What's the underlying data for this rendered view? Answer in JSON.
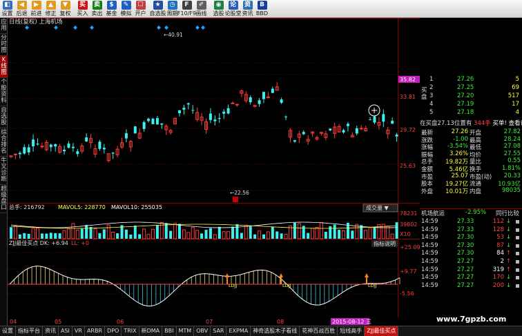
{
  "toolbar": [
    {
      "name": "sell-back-button",
      "label": "设置",
      "color": "#3a6ab8",
      "glyph": "◧"
    },
    {
      "name": "back-button",
      "label": "后退",
      "color": "#e09a20",
      "glyph": "◀"
    },
    {
      "name": "forward-button",
      "label": "前进",
      "color": "#e09a20",
      "glyph": "▶"
    },
    {
      "name": "up-button",
      "label": "修正",
      "color": "#e09a20",
      "glyph": "▲"
    },
    {
      "name": "down-button",
      "label": "复权",
      "color": "#e09a20",
      "glyph": "▼"
    },
    {
      "name": "buy-button",
      "label": "买入",
      "color": "#d01010",
      "glyph": "买"
    },
    {
      "name": "sell-button",
      "label": "卖出",
      "color": "#108010",
      "glyph": "卖"
    },
    {
      "name": "fund-button",
      "label": "基金",
      "color": "#2060c0",
      "glyph": "$"
    },
    {
      "name": "simulate-button",
      "label": "模拟",
      "color": "#2060c0",
      "glyph": "✎"
    },
    {
      "name": "open-account-button",
      "label": "开户",
      "color": "#c04040",
      "glyph": "☐"
    },
    {
      "name": "watchlist-button",
      "label": "自选股",
      "color": "#2050a0",
      "glyph": "★"
    },
    {
      "name": "period-button",
      "label": "周期",
      "color": "#2070c0",
      "glyph": "◷"
    },
    {
      "name": "f10-button",
      "label": "F10/F9",
      "color": "#404040",
      "glyph": "F"
    },
    {
      "name": "draw-line-button",
      "label": "画线",
      "color": "#606060",
      "glyph": "✐"
    },
    {
      "name": "stock-picker-button",
      "label": "选股",
      "color": "#208040",
      "glyph": "◉"
    },
    {
      "name": "forum-button",
      "label": "论股堂",
      "color": "#2060c0",
      "glyph": "论"
    },
    {
      "name": "news-button",
      "label": "资讯",
      "color": "#3070b0",
      "glyph": "资"
    },
    {
      "name": "bbd-button",
      "label": "BBD",
      "color": "#1040a0",
      "glyph": "B"
    }
  ],
  "left_tabs": [
    "应用",
    "分时图",
    "K线图",
    "个股资料",
    "自选股",
    "综合排名",
    "牛叉诊断",
    "超级盘口"
  ],
  "left_tab_active": 2,
  "chart": {
    "title": "日线(复权)  上海机场",
    "price_axis": [
      "33.81",
      "29.72",
      "25.63"
    ],
    "highlight_price": "35.82",
    "price_high_label": "40.91",
    "price_low_label": "22.56",
    "volume_header": {
      "total": "总手: 216792",
      "mavol5": "MAVOL5: 228770",
      "mavol10": "MAVOL10: 255035",
      "select_label": "成交量"
    },
    "volume_axis": [
      "78231",
      "39802",
      "X10"
    ],
    "indicator_header": {
      "name": "ZJJ最佳买点 DK: +6.94",
      "ll": "LL: +0",
      "explain_label": "指标说明"
    },
    "indicator_axis": [
      "+25.09",
      "+9.77",
      "-5.56"
    ],
    "buy_marker_label": "LDJJ",
    "date_axis": [
      "04",
      "05",
      "06",
      "07",
      "08"
    ],
    "current_date": "2015-08-12 三",
    "colors": {
      "up": "#ff3c3c",
      "down": "#3cf0f0",
      "ma5": "#ffffff",
      "ma10": "#ffff40",
      "highlight": "#c020c0",
      "grid": "#7a0000"
    }
  },
  "orderbook": {
    "sell": [
      {
        "n": "1",
        "price": "27.26",
        "vol": "5"
      },
      {
        "n": "2",
        "price": "27.25",
        "vol": "69"
      },
      {
        "n": "3",
        "price": "27.20",
        "vol": "517"
      },
      {
        "n": "4",
        "price": "27.19",
        "vol": "17"
      },
      {
        "n": "5",
        "price": "27.18",
        "vol": "4"
      }
    ],
    "side_label": "买盘",
    "summary": {
      "left": "在买盘27.13位置有",
      "qty": "344手",
      "right": "买单! 查看详细"
    }
  },
  "stats": [
    {
      "l1": "最新",
      "v1": "27.26",
      "l2": "开盘",
      "v2": "27.82"
    },
    {
      "l1": "涨跌",
      "v1": "-1.00",
      "l2": "最高",
      "v2": "28.24"
    },
    {
      "l1": "涨幅",
      "v1": "-3.54%",
      "l2": "最低",
      "v2": "27.08"
    },
    {
      "l1": "振幅",
      "v1": "3.26%",
      "l2": "均价",
      "v2": "27.55"
    },
    {
      "l1": "总手",
      "v1": "19.82万",
      "l2": "量比",
      "v2": "0.55"
    },
    {
      "l1": "金额",
      "v1": "5.46亿",
      "l2": "换手",
      "v2": "1.81%"
    },
    {
      "l1": "市盈",
      "v1": "25.07",
      "l2": "市盈(动)",
      "v2": "20.33"
    },
    {
      "l1": "股本",
      "v1": "19.27亿",
      "l2": "流通",
      "v2": "10.93亿"
    },
    {
      "l1": "外盘",
      "v1": "10.01万",
      "l2": "内盘",
      "v2": "98035"
    }
  ],
  "ticker_header": {
    "name": "机场航运",
    "change": "-2.95%",
    "link": "同行比较"
  },
  "ticks": [
    {
      "time": "14:59",
      "price": "27.33",
      "vol": "112",
      "dir": "down"
    },
    {
      "time": "14:59",
      "price": "27.33",
      "vol": "128",
      "dir": "down"
    },
    {
      "time": "14:59",
      "price": "27.30",
      "vol": "53",
      "dir": "down"
    },
    {
      "time": "14:59",
      "price": "27.30",
      "vol": "87",
      "dir": "down"
    },
    {
      "time": "14:59",
      "price": "27.30",
      "vol": "84",
      "dir": "up"
    },
    {
      "time": "14:59",
      "price": "27.27",
      "vol": "2",
      "dir": "up"
    },
    {
      "time": "14:59",
      "price": "27.27",
      "vol": "319",
      "dir": "up"
    },
    {
      "time": "14:59",
      "price": "27.27",
      "vol": "170",
      "dir": "down"
    },
    {
      "time": "14:59",
      "price": "27.27",
      "vol": "200",
      "dir": "down"
    }
  ],
  "bottom_tabs": [
    "设置",
    "指标平台",
    "资讯",
    "ASI",
    "VR",
    "ARBR",
    "DPO",
    "TRIX",
    "新DMA",
    "BBI",
    "MTM",
    "OBV",
    "SAR",
    "EXPMA",
    "神奇选股木子看线",
    "花神百战百胜",
    "短线高手",
    "ZJJ最佳买点"
  ],
  "bottom_active": 17,
  "watermark": "www.7gpzb.com"
}
